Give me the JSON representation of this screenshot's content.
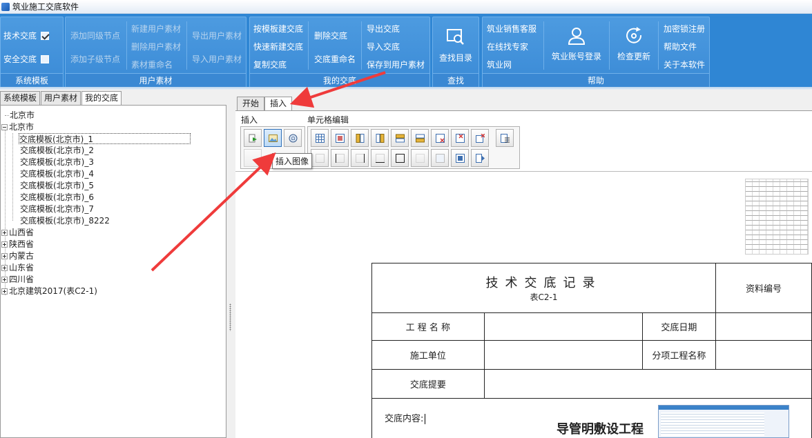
{
  "window": {
    "title": "筑业施工交底软件"
  },
  "ribbon": {
    "groups": {
      "system_templates": {
        "label": "系统模板",
        "items": [
          {
            "label": "技术交底",
            "checked": true
          },
          {
            "label": "安全交底",
            "checked": false
          }
        ]
      },
      "user_materials": {
        "label": "用户素材",
        "items": {
          "add_sibling": "添加同级节点",
          "add_child": "添加子级节点",
          "new_material": "新建用户素材",
          "delete_material": "删除用户素材",
          "rename_material": "素材重命名",
          "export_material": "导出用户素材",
          "import_material": "导入用户素材"
        }
      },
      "my_disclosure": {
        "label": "我的交底",
        "items": {
          "from_template": "按模板建交底",
          "quick_new": "快速新建交底",
          "copy": "复制交底",
          "delete": "删除交底",
          "rename": "交底重命名",
          "export": "导出交底",
          "import": "导入交底",
          "save_to_material": "保存到用户素材"
        }
      },
      "search": {
        "label": "查找",
        "items": {
          "find_toc": "查找目录"
        }
      },
      "help": {
        "label": "帮助",
        "items": {
          "sales_service": "筑业销售客服",
          "online_expert": "在线找专家",
          "website": "筑业网",
          "account_login": "筑业账号登录",
          "check_update": "检查更新",
          "register_key": "加密锁注册",
          "help_file": "帮助文件",
          "about": "关于本软件"
        }
      }
    }
  },
  "left_panel": {
    "tabs": [
      {
        "label": "系统模板"
      },
      {
        "label": "用户素材"
      },
      {
        "label": "我的交底",
        "active": true
      }
    ],
    "tree": [
      {
        "label": "北京市",
        "expander": "none"
      },
      {
        "label": "北京市",
        "expander": "minus"
      },
      {
        "label": "交底模板(北京市)_1",
        "selected": true
      },
      {
        "label": "交底模板(北京市)_2"
      },
      {
        "label": "交底模板(北京市)_3"
      },
      {
        "label": "交底模板(北京市)_4"
      },
      {
        "label": "交底模板(北京市)_5"
      },
      {
        "label": "交底模板(北京市)_6"
      },
      {
        "label": "交底模板(北京市)_7"
      },
      {
        "label": "交底模板(北京市)_8222"
      },
      {
        "label": "山西省",
        "expander": "plus"
      },
      {
        "label": "陕西省",
        "expander": "plus"
      },
      {
        "label": "内蒙古",
        "expander": "plus"
      },
      {
        "label": "山东省",
        "expander": "plus"
      },
      {
        "label": "四川省",
        "expander": "plus"
      },
      {
        "label": "北京建筑2017(表C2-1)",
        "expander": "plus"
      }
    ]
  },
  "editor": {
    "tabs": [
      {
        "label": "开始"
      },
      {
        "label": "插入",
        "active": true
      }
    ],
    "section_insert": "插入",
    "section_cell_edit": "单元格编辑",
    "tooltip": "插入图像",
    "toolbar_icons": {
      "insert": [
        "insert-file-icon",
        "insert-image-icon",
        "insert-symbol-icon"
      ],
      "cell_row1": [
        "table-icon",
        "merge-cells-icon",
        "insert-column-left-icon",
        "insert-column-right-icon",
        "insert-row-above-icon",
        "insert-row-below-icon",
        "delete-row-icon",
        "delete-column-icon",
        "delete-table-icon",
        "table-properties-icon"
      ],
      "cell_row2": [
        "border-none-icon",
        "border-left-icon",
        "border-right-icon",
        "border-top-icon",
        "border-bottom-icon",
        "border-all-icon",
        "border-inner-icon",
        "cell-shade-icon",
        "cell-align-icon"
      ]
    }
  },
  "document": {
    "form_title": "技术交底记录",
    "form_subtitle": "表C2-1",
    "labels": {
      "doc_no": "资料编号",
      "project_name": "工 程 名 称",
      "date": "交底日期",
      "contractor": "施工单位",
      "sub_project": "分项工程名称",
      "summary": "交底提要",
      "content": "交底内容:"
    },
    "heading": "导管明敷设工程"
  },
  "colors": {
    "ribbon_blue": "#2f86d4",
    "annotation_red": "#ef3b3b"
  }
}
